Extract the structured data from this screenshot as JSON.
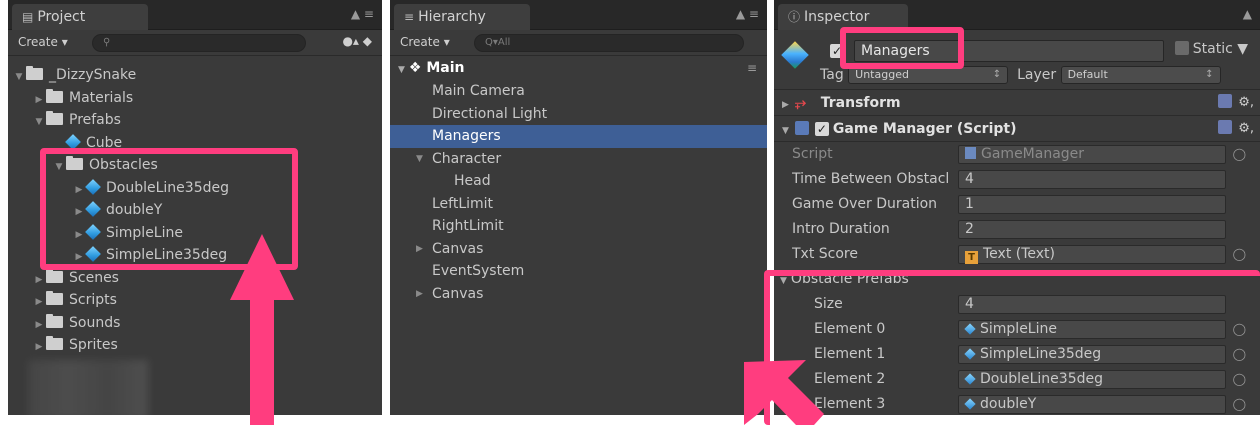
{
  "project": {
    "tab_title": "Project",
    "create_label": "Create",
    "tree": [
      {
        "label": "_DizzySnake",
        "type": "folder",
        "indent": 0,
        "expanded": true
      },
      {
        "label": "Materials",
        "type": "folder",
        "indent": 1,
        "expanded": false
      },
      {
        "label": "Prefabs",
        "type": "folder",
        "indent": 1,
        "expanded": true
      },
      {
        "label": "Cube",
        "type": "prefab",
        "indent": 2
      },
      {
        "label": "Obstacles",
        "type": "folder",
        "indent": 2,
        "expanded": true
      },
      {
        "label": "DoubleLine35deg",
        "type": "prefab",
        "indent": 3
      },
      {
        "label": "doubleY",
        "type": "prefab",
        "indent": 3
      },
      {
        "label": "SimpleLine",
        "type": "prefab",
        "indent": 3
      },
      {
        "label": "SimpleLine35deg",
        "type": "prefab",
        "indent": 3
      },
      {
        "label": "Scenes",
        "type": "folder",
        "indent": 1,
        "expanded": false
      },
      {
        "label": "Scripts",
        "type": "folder",
        "indent": 1,
        "expanded": false
      },
      {
        "label": "Sounds",
        "type": "folder",
        "indent": 1,
        "expanded": false
      },
      {
        "label": "Sprites",
        "type": "folder",
        "indent": 1,
        "expanded": false
      }
    ]
  },
  "hierarchy": {
    "tab_title": "Hierarchy",
    "create_label": "Create",
    "search_placeholder": "Q▾All",
    "scene_name": "Main",
    "items": [
      {
        "label": "Main Camera",
        "indent": 0
      },
      {
        "label": "Directional Light",
        "indent": 0
      },
      {
        "label": "Managers",
        "indent": 0,
        "selected": true
      },
      {
        "label": "Character",
        "indent": 0,
        "expanded": true
      },
      {
        "label": "Head",
        "indent": 1
      },
      {
        "label": "LeftLimit",
        "indent": 0
      },
      {
        "label": "RightLimit",
        "indent": 0
      },
      {
        "label": "Canvas",
        "indent": 0,
        "collapsed": true
      },
      {
        "label": "EventSystem",
        "indent": 0
      },
      {
        "label": "Canvas",
        "indent": 0,
        "collapsed": true
      }
    ]
  },
  "inspector": {
    "tab_title": "Inspector",
    "object_name": "Managers",
    "static_label": "Static",
    "tag_label": "Tag",
    "tag_value": "Untagged",
    "layer_label": "Layer",
    "layer_value": "Default",
    "transform_label": "Transform",
    "component_label": "Game Manager (Script)",
    "script_label": "Script",
    "script_value": "GameManager",
    "props": [
      {
        "label": "Time Between Obstacl",
        "value": "4"
      },
      {
        "label": "Game Over Duration",
        "value": "1"
      },
      {
        "label": "Intro Duration",
        "value": "2"
      },
      {
        "label": "Txt Score",
        "value": "Text (Text)"
      }
    ],
    "array_label": "Obstacle Prefabs",
    "size_label": "Size",
    "size_value": "4",
    "elements": [
      {
        "label": "Element 0",
        "value": "SimpleLine"
      },
      {
        "label": "Element 1",
        "value": "SimpleLine35deg"
      },
      {
        "label": "Element 2",
        "value": "DoubleLine35deg"
      },
      {
        "label": "Element 3",
        "value": "doubleY"
      }
    ]
  },
  "colors": {
    "highlight": "#ff3d7f",
    "selection": "#3e5f96",
    "panel": "#3a3a3a"
  }
}
